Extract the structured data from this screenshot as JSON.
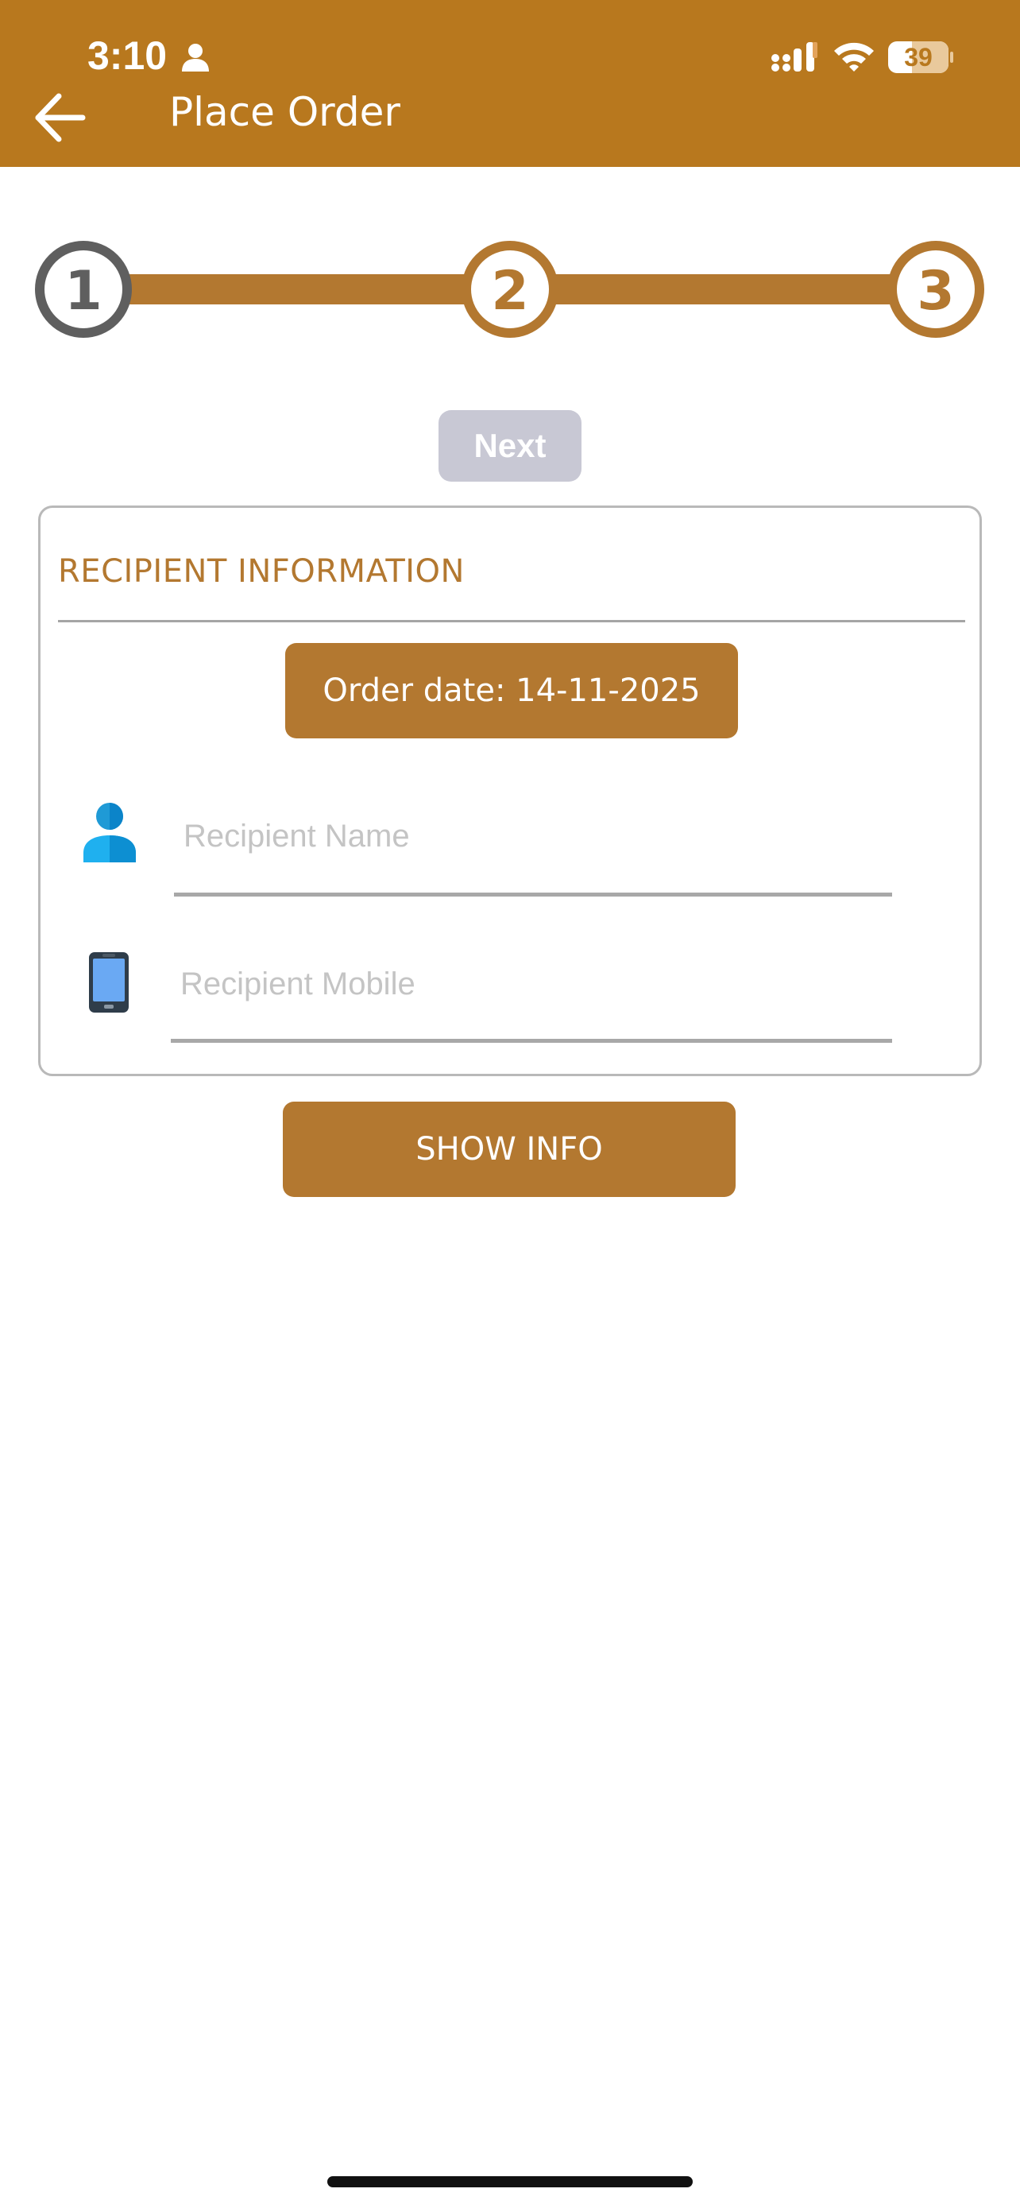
{
  "status_bar": {
    "time": "3:10",
    "battery": "39",
    "icons": [
      "person-icon",
      "cellular-signal-icon",
      "wifi-icon",
      "battery-icon"
    ]
  },
  "header": {
    "title": "Place Order",
    "back_icon": "arrow-left-icon",
    "background_color": "#b8781e"
  },
  "stepper": {
    "current_step": 1,
    "steps": [
      {
        "label": "1"
      },
      {
        "label": "2"
      },
      {
        "label": "3"
      }
    ],
    "active_color": "#5f5f5f",
    "inactive_color": "#b37830"
  },
  "next_button": {
    "label": "Next"
  },
  "recipient_card": {
    "title": "RECIPIENT INFORMATION",
    "order_date_label": "Order date: 14-11-2025",
    "name_field": {
      "value": "",
      "placeholder": "Recipient Name",
      "icon": "person-icon"
    },
    "mobile_field": {
      "value": "",
      "placeholder": "Recipient Mobile",
      "icon": "mobile-phone-icon"
    }
  },
  "show_info_button": {
    "label": "SHOW INFO"
  },
  "accent_color": "#b37830"
}
